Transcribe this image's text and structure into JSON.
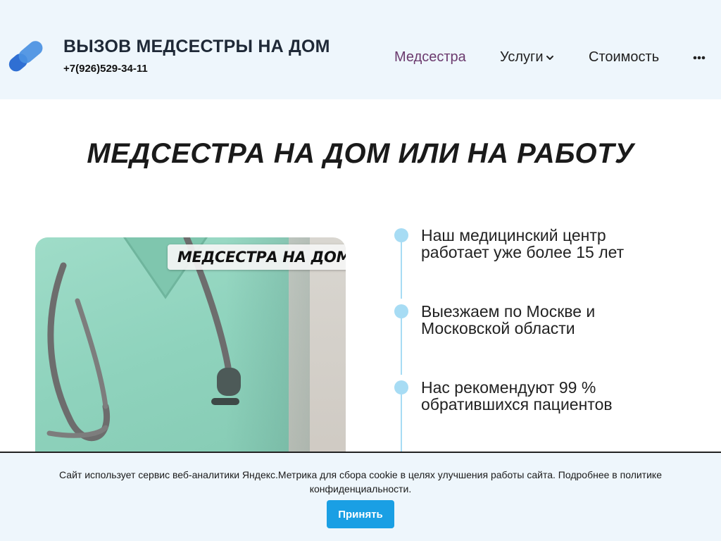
{
  "header": {
    "logo_icon": "capsule-logo-icon",
    "title": "ВЫЗОВ МЕДСЕСТРЫ НА ДОМ",
    "phone": "+7(926)529-34-11",
    "nav": {
      "medsestra": "Медсестра",
      "uslugi": "Услуги",
      "stoimost": "Стоимость",
      "more_icon": "more-dots-icon"
    },
    "active_color": "#6b3a6e"
  },
  "main": {
    "title": "МЕДСЕСТРА НА ДОМ ИЛИ НА РАБОТУ",
    "hero_badge": "МЕДСЕСТРА НА ДОМ",
    "features": [
      {
        "text": "Наш медицинский центр работает уже более 15 лет"
      },
      {
        "text": "Выезжаем по Москве и Московской области"
      },
      {
        "text": "Нас рекомендуют 99 % обратившихся пациентов"
      }
    ],
    "accent_color": "#a7dcf4"
  },
  "cookie": {
    "text": "Сайт использует сервис веб-аналитики Яндекс.Метрика для сбора cookie в целях улучшения работы сайта. Подробнее в политике конфиденциальности.",
    "accept_label": "Принять",
    "button_color": "#1a9fe4"
  }
}
